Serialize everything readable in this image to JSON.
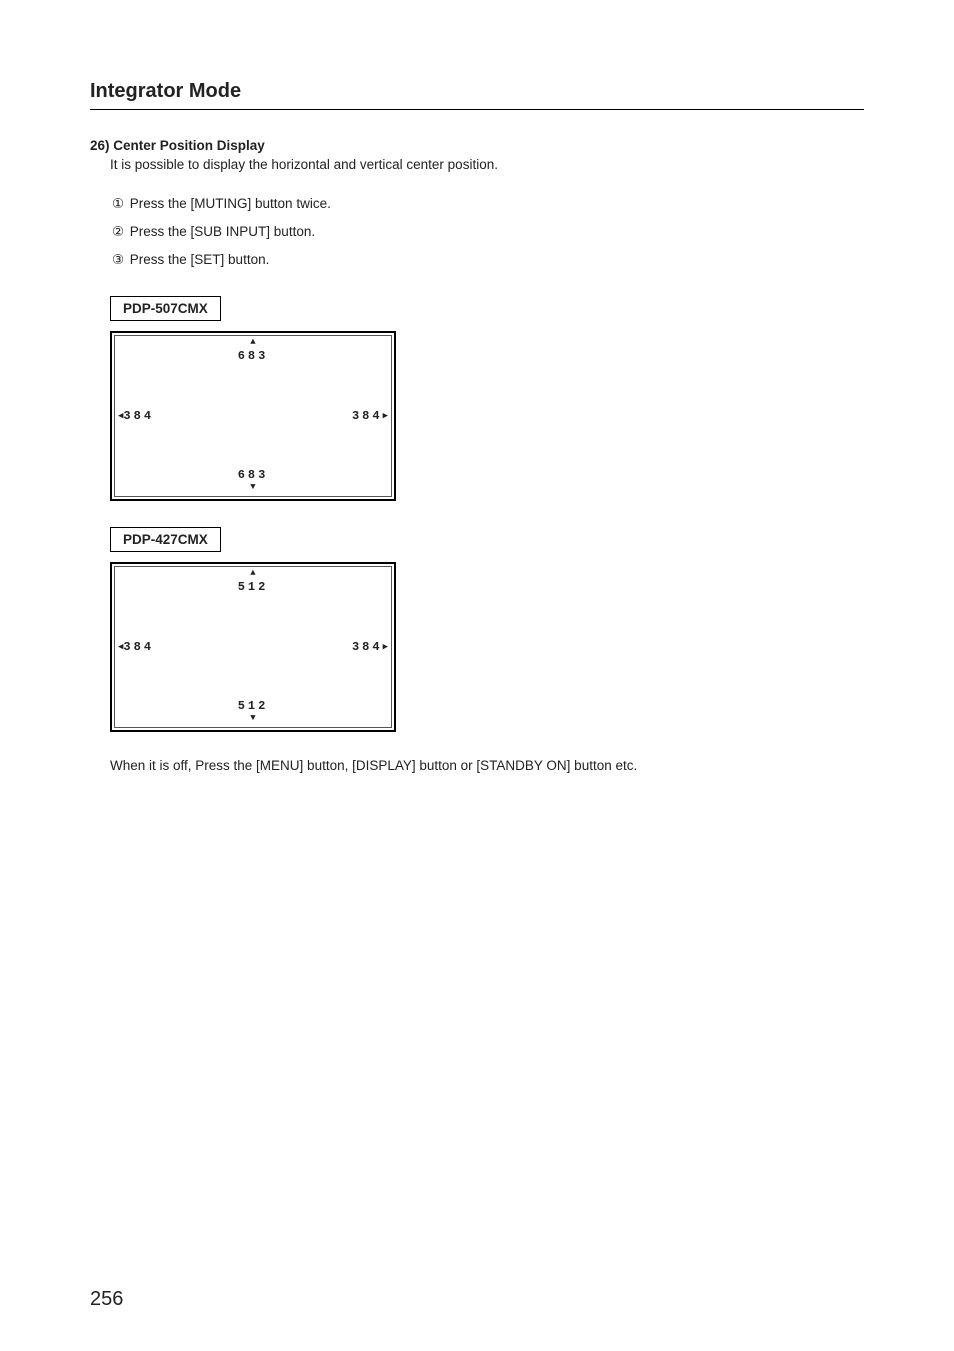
{
  "header": {
    "title": "Integrator Mode"
  },
  "item": {
    "number": "26)",
    "heading": "Center Position Display",
    "description": "It is possible to display the horizontal and vertical center position."
  },
  "steps": [
    {
      "n": "①",
      "text": "Press the [MUTING] button twice."
    },
    {
      "n": "②",
      "text": "Press the [SUB INPUT] button."
    },
    {
      "n": "③",
      "text": "Press the [SET] button."
    }
  ],
  "panels": [
    {
      "model": "PDP-507CMX",
      "top": "683",
      "bottom": "683",
      "left": "384",
      "right": "384"
    },
    {
      "model": "PDP-427CMX",
      "top": "512",
      "bottom": "512",
      "left": "384",
      "right": "384"
    }
  ],
  "post_note": "When it is off, Press the [MENU] button, [DISPLAY] button or [STANDBY ON] button etc.",
  "page_number": "256",
  "glyphs": {
    "tri_up": "▲",
    "tri_down": "▼",
    "tri_left": "◀",
    "tri_right": "▶"
  }
}
